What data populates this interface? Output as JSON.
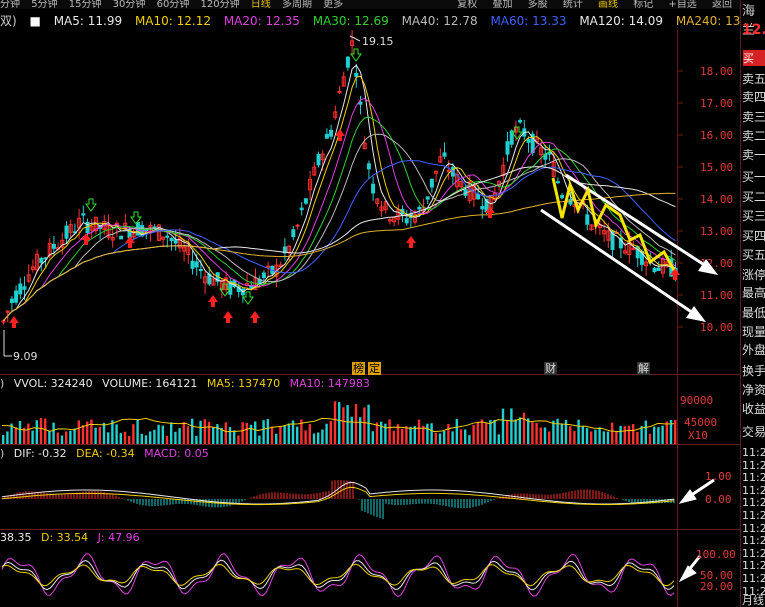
{
  "topbar": {
    "periods": [
      "分钟",
      "5分钟",
      "15分钟",
      "30分钟",
      "60分钟",
      "120分钟",
      "日线",
      "多周期",
      "更多"
    ],
    "active": "日线",
    "right": [
      "复权",
      "叠加",
      "多股",
      "统计",
      "画线",
      "标记",
      "+自选",
      "返回"
    ]
  },
  "legend": {
    "prefix": "双)",
    "items": [
      {
        "label": "MA5: 11.99",
        "color": "#e8e8e8"
      },
      {
        "label": "MA10: 12.12",
        "color": "#f0d000"
      },
      {
        "label": "MA20: 12.35",
        "color": "#e040e0"
      },
      {
        "label": "MA30: 12.69",
        "color": "#30d030"
      },
      {
        "label": "MA40: 12.78",
        "color": "#bbbbbb"
      },
      {
        "label": "MA60: 13.33",
        "color": "#4060ff"
      },
      {
        "label": "MA120: 14.09",
        "color": "#e8e8e8"
      },
      {
        "label": "MA240: 13",
        "color": "#e0b030"
      }
    ]
  },
  "price_axis": [
    "18.00",
    "17.00",
    "16.00",
    "15.00",
    "14.00",
    "13.00",
    "12.00",
    "11.00",
    "10.00"
  ],
  "high_label": "19.15",
  "low_label": "9.09",
  "event_tags": [
    "榜",
    "定",
    "财",
    "解"
  ],
  "volume": {
    "legend": [
      {
        "label": "VVOL: 324240",
        "color": "#e8e8e8"
      },
      {
        "label": "VOLUME: 164121",
        "color": "#e8e8e8"
      },
      {
        "label": "MA5: 137470",
        "color": "#f0d000"
      },
      {
        "label": "MA10: 147983",
        "color": "#e040e0"
      }
    ],
    "prefix": ")",
    "axis": [
      "90000",
      "45000"
    ],
    "unit": "X10"
  },
  "macd": {
    "legend": [
      {
        "label": "DIF: -0.32",
        "color": "#e8e8e8"
      },
      {
        "label": "DEA: -0.34",
        "color": "#f0d000"
      },
      {
        "label": "MACD: 0.05",
        "color": "#e040e0"
      }
    ],
    "prefix": ")",
    "axis": [
      "1.00",
      "0.00"
    ]
  },
  "kdj": {
    "legend": [
      {
        "label": "38.35",
        "color": "#e8e8e8"
      },
      {
        "label": "D: 33.54",
        "color": "#f0d000"
      },
      {
        "label": "J: 47.96",
        "color": "#e040e0"
      }
    ],
    "axis": [
      "100.00",
      "50.00",
      "20.00"
    ]
  },
  "right_panel": {
    "stock_name": "海兰",
    "price": "12.",
    "buy_button": "买",
    "labels": [
      "卖五",
      "卖四",
      "卖三",
      "卖二",
      "卖一",
      "买一",
      "买二",
      "买三",
      "买四",
      "买五",
      "涨停",
      "最高",
      "最低",
      "现量",
      "外盘",
      "换手",
      "净资",
      "收益",
      "交易"
    ],
    "times": [
      "11:2",
      "11:2",
      "11:2",
      "11:2",
      "11:2",
      "11:2",
      "11:2",
      "11:2",
      "11:2",
      "11:2",
      "11:2",
      "11:2"
    ],
    "footer": "月线"
  },
  "colors": {
    "up": "#ff3030",
    "down": "#20d0d0",
    "axis_text": "#e23a3a",
    "grid": "#551818"
  }
}
